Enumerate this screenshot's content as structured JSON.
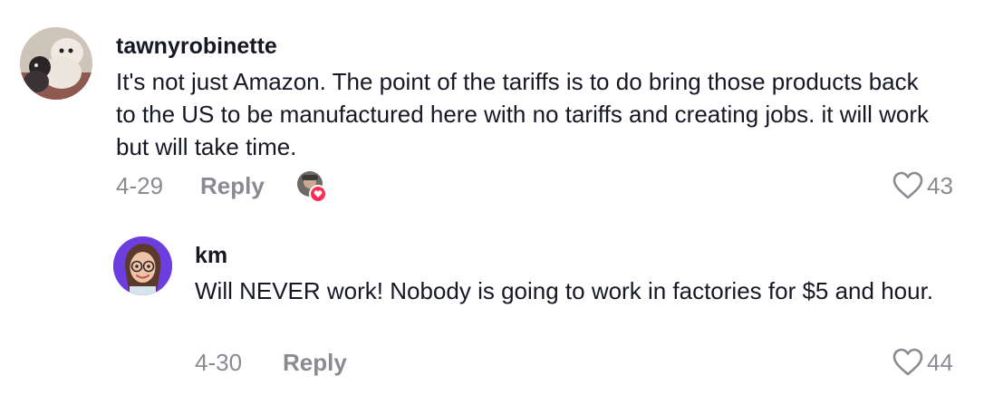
{
  "comments": [
    {
      "username": "tawnyrobinette",
      "text": "It's not just Amazon. The point of the tariffs is to do bring those products back to the US to be manufactured here with no tariffs and creating jobs. it will work but will take time.",
      "date": "4-29",
      "reply_label": "Reply",
      "likes": "43",
      "creator_liked": true
    },
    {
      "username": "km",
      "text": "Will NEVER work! Nobody is going to work in factories for $5 and hour.",
      "date": "4-30",
      "reply_label": "Reply",
      "likes": "44"
    }
  ],
  "colors": {
    "text_primary": "#161823",
    "text_secondary": "#8a8b91",
    "heart_badge": "#fe2c55"
  }
}
